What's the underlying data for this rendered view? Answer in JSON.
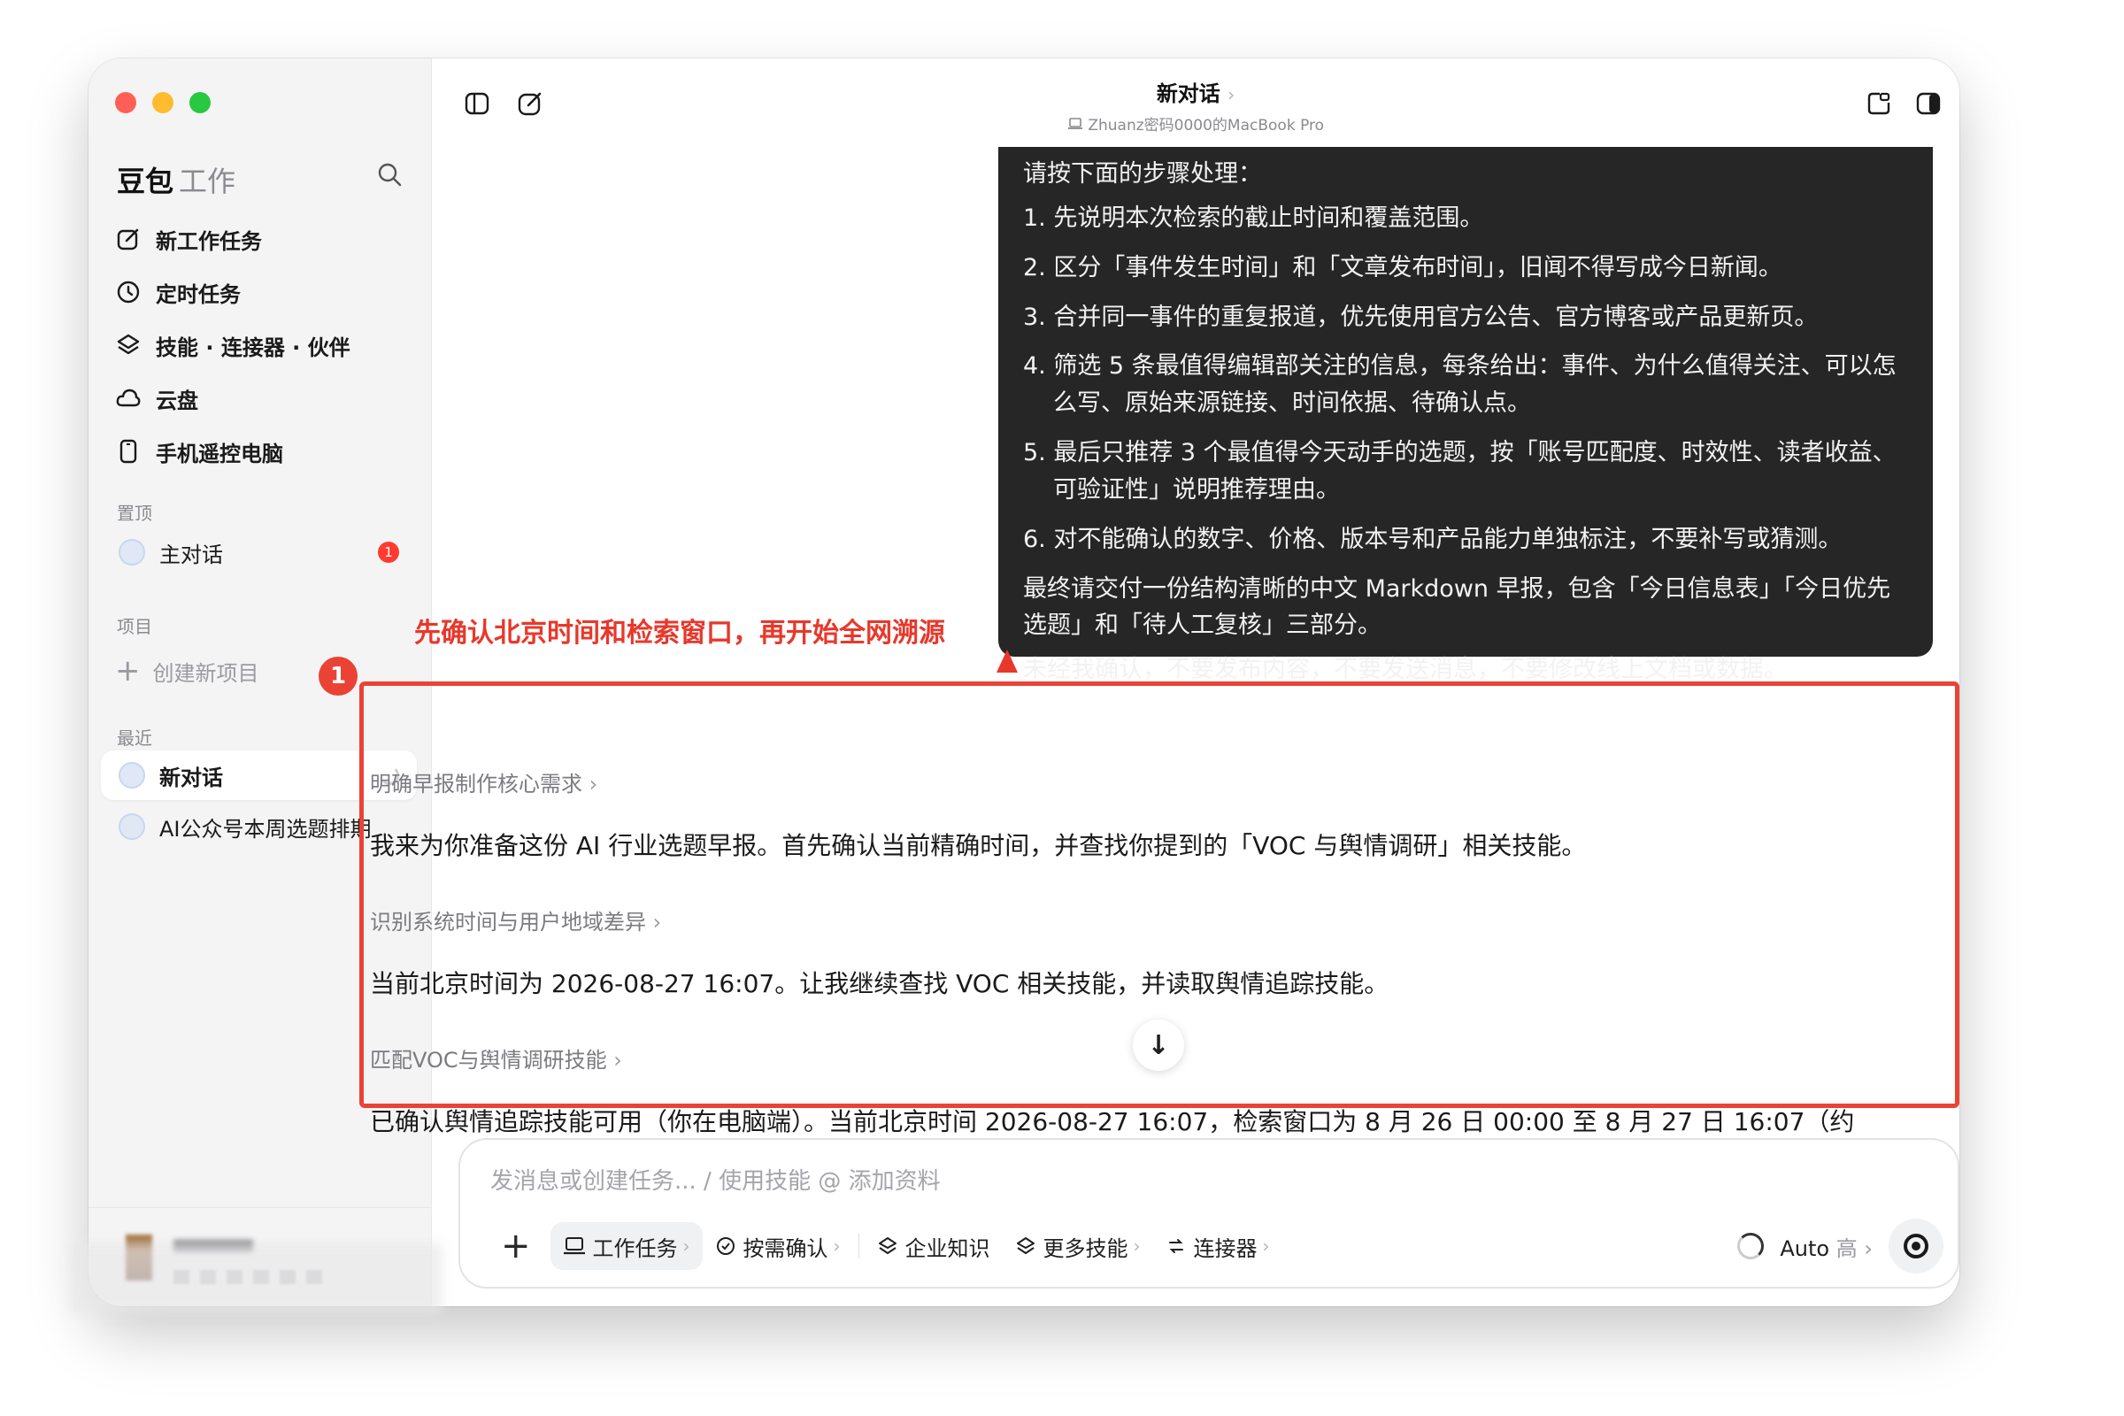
{
  "sidebar": {
    "brand": "豆包",
    "brand_sub": "工作",
    "nav": [
      {
        "label": "新工作任务",
        "icon": "edit-icon"
      },
      {
        "label": "定时任务",
        "icon": "clock-icon"
      },
      {
        "label": "技能 · 连接器 · 伙伴",
        "icon": "layers-icon"
      },
      {
        "label": "云盘",
        "icon": "cloud-icon"
      },
      {
        "label": "手机遥控电脑",
        "icon": "phone-icon"
      }
    ],
    "pinned_label": "置顶",
    "pinned_item": "主对话",
    "pinned_badge": "1",
    "projects_label": "项目",
    "create_project": "创建新项目",
    "recent_label": "最近",
    "recent_items": [
      "新对话",
      "AI公众号本周选题排期"
    ]
  },
  "topbar": {
    "title": "新对话",
    "device": "Zhuanz密码0000的MacBook Pro"
  },
  "user_message": {
    "intro": "请按下面的步骤处理：",
    "steps": [
      "1. 先说明本次检索的截止时间和覆盖范围。",
      "2. 区分「事件发生时间」和「文章发布时间」，旧闻不得写成今日新闻。",
      "3. 合并同一事件的重复报道，优先使用官方公告、官方博客或产品更新页。",
      "4. 筛选 5 条最值得编辑部关注的信息，每条给出：事件、为什么值得关注、可以怎么写、原始来源链接、时间依据、待确认点。",
      "5. 最后只推荐 3 个最值得今天动手的选题，按「账号匹配度、时效性、读者收益、可验证性」说明推荐理由。",
      "6. 对不能确认的数字、价格、版本号和产品能力单独标注，不要补写或猜测。"
    ],
    "closing1": "最终请交付一份结构清晰的中文 Markdown 早报，包含「今日信息表」「今日优先选题」和「待人工复核」三部分。",
    "closing2": "未经我确认，不要发布内容，不要发送消息，不要修改线上文档或数据。"
  },
  "annotation": {
    "number": "1",
    "text": "先确认北京时间和检索窗口，再开始全网溯源"
  },
  "assistant": {
    "step1_label": "明确早报制作核心需求",
    "step1_text": "我来为你准备这份 AI 行业选题早报。首先确认当前精确时间，并查找你提到的「VOC 与舆情调研」相关技能。",
    "step2_label": "识别系统时间与用户地域差异",
    "step2_text": "当前北京时间为 2026-08-27 16:07。让我继续查找 VOC 相关技能，并读取舆情追踪技能。",
    "step3_label": "匹配VOC与舆情调研技能",
    "step3_text": "已确认舆情追踪技能可用（你在电脑端）。当前北京时间 2026-08-27 16:07，检索窗口为 8 月 26 日 00:00 至 8 月 27 日 16:07（约"
  },
  "composer": {
    "placeholder": "发消息或创建任务... / 使用技能 @ 添加资料",
    "tools": {
      "work_task": "工作任务",
      "confirm": "按需确认",
      "knowledge": "企业知识",
      "more_skills": "更多技能",
      "connectors": "连接器"
    },
    "model": "Auto",
    "model_level": "高"
  }
}
